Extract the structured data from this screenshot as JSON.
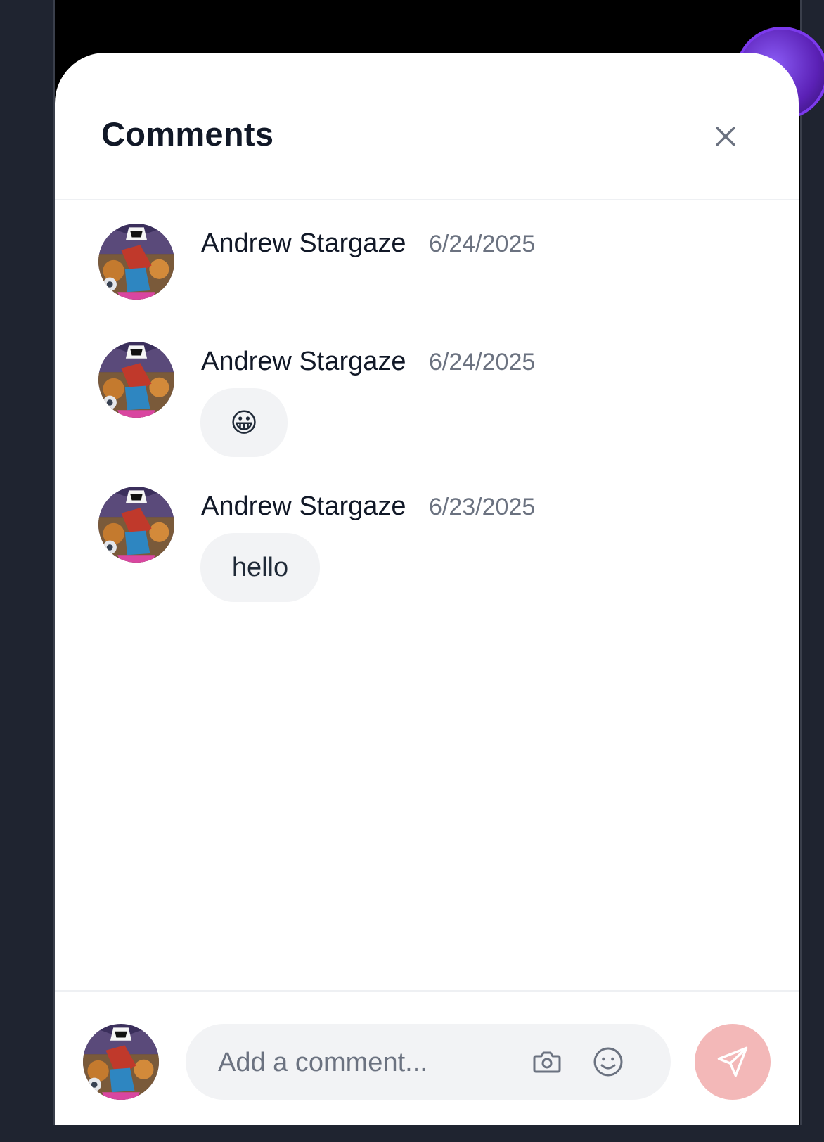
{
  "sheet": {
    "title": "Comments",
    "close_icon": "close-icon"
  },
  "comments": [
    {
      "author": "Andrew Stargaze",
      "date": "6/24/2025",
      "text": ""
    },
    {
      "author": "Andrew Stargaze",
      "date": "6/24/2025",
      "text": "😀"
    },
    {
      "author": "Andrew Stargaze",
      "date": "6/23/2025",
      "text": "hello"
    }
  ],
  "composer": {
    "placeholder": "Add a comment...",
    "value": "",
    "camera_icon": "camera-icon",
    "emoji_icon": "smiley-icon",
    "send_icon": "paper-plane-icon"
  },
  "colors": {
    "backdrop": "#1f2430",
    "send_button": "#f3b8b8",
    "bubble": "#f2f3f5"
  }
}
